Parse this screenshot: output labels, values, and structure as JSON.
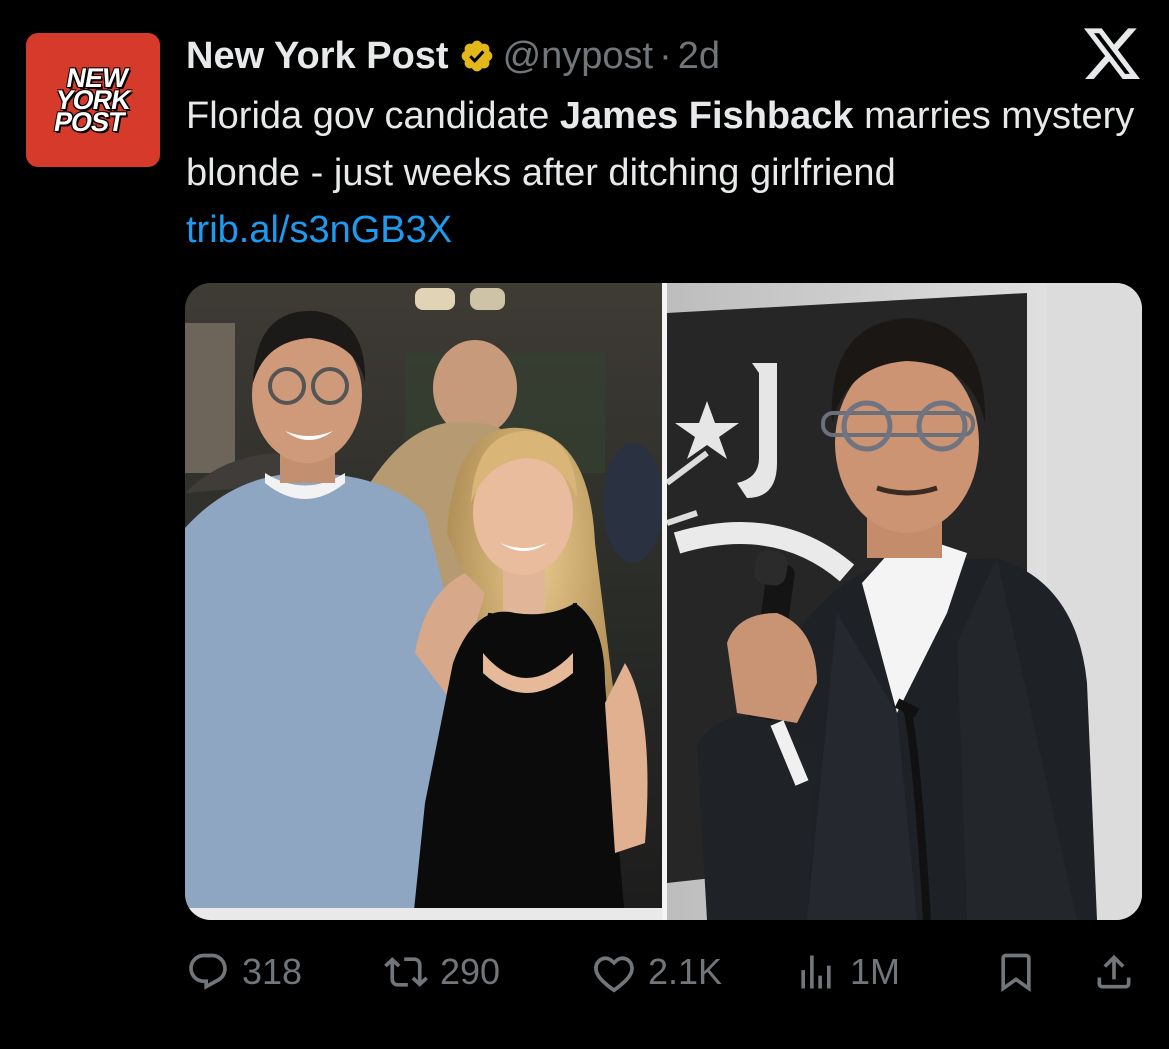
{
  "account": {
    "avatar_text": [
      "NEW",
      "YORK",
      "POST"
    ],
    "display_name": "New York Post",
    "verified": true,
    "handle": "@nypost",
    "separator": "·",
    "time": "2d"
  },
  "post": {
    "text_before": "Florida gov candidate ",
    "bold_name": "James Fishback",
    "text_after": " marries mystery blonde - just weeks after ditching girlfriend ",
    "link": "trib.al/s3nGB3X"
  },
  "media": {
    "left_photo": "photo-couple",
    "right_photo": "photo-speaker-microphone"
  },
  "actions": {
    "replies": "318",
    "reposts": "290",
    "likes": "2.1K",
    "views": "1M"
  },
  "icons": {
    "reply": "reply-icon",
    "repost": "repost-icon",
    "like": "heart-icon",
    "views": "views-icon",
    "bookmark": "bookmark-icon",
    "share": "share-icon",
    "platform": "x-logo-icon",
    "verified": "verified-badge-icon"
  },
  "colors": {
    "background": "#000000",
    "text": "#e7e9ea",
    "muted": "#71767b",
    "link": "#1d9bf0",
    "verified_gold": "#e2b719",
    "avatar_red": "#d63a2a"
  }
}
